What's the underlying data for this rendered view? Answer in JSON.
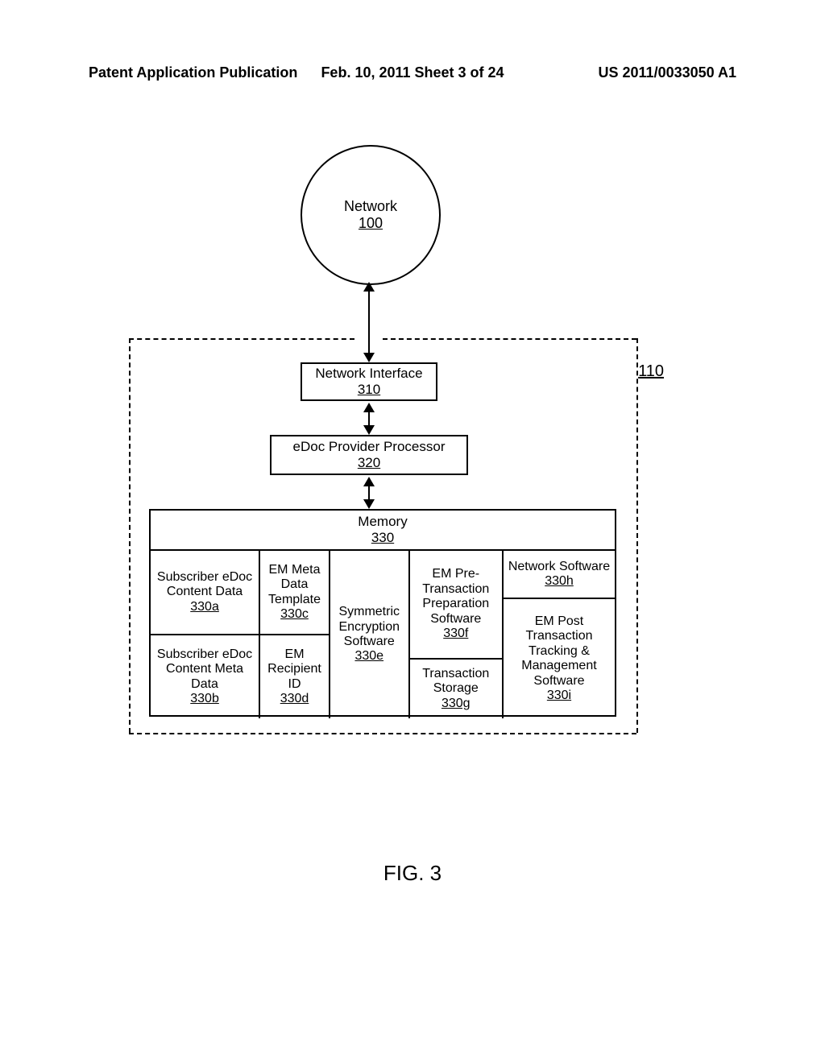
{
  "header": {
    "left": "Patent Application Publication",
    "center": "Feb. 10, 2011  Sheet 3 of 24",
    "right": "US 2011/0033050 A1"
  },
  "figure_caption": "FIG. 3",
  "diagram": {
    "network": {
      "label": "Network",
      "ref": "100"
    },
    "container_ref": "110",
    "network_interface": {
      "label": "Network Interface",
      "ref": "310"
    },
    "processor": {
      "label": "eDoc Provider Processor",
      "ref": "320"
    },
    "memory": {
      "label": "Memory",
      "ref": "330",
      "cells": {
        "a": {
          "label": "Subscriber eDoc Content Data",
          "ref": "330a"
        },
        "b": {
          "label": "Subscriber eDoc Content Meta Data",
          "ref": "330b"
        },
        "c": {
          "label": "EM Meta Data Template",
          "ref": "330c"
        },
        "d": {
          "label": "EM Recipient ID",
          "ref": "330d"
        },
        "e": {
          "label": "Symmetric Encryption Software",
          "ref": "330e"
        },
        "f": {
          "label": "EM Pre-Transaction Preparation Software",
          "ref": "330f"
        },
        "g": {
          "label": "Transaction Storage",
          "ref": "330g"
        },
        "h": {
          "label": "Network Software",
          "ref": "330h"
        },
        "i": {
          "label": "EM Post Transaction Tracking & Management Software",
          "ref": "330i"
        }
      }
    }
  }
}
